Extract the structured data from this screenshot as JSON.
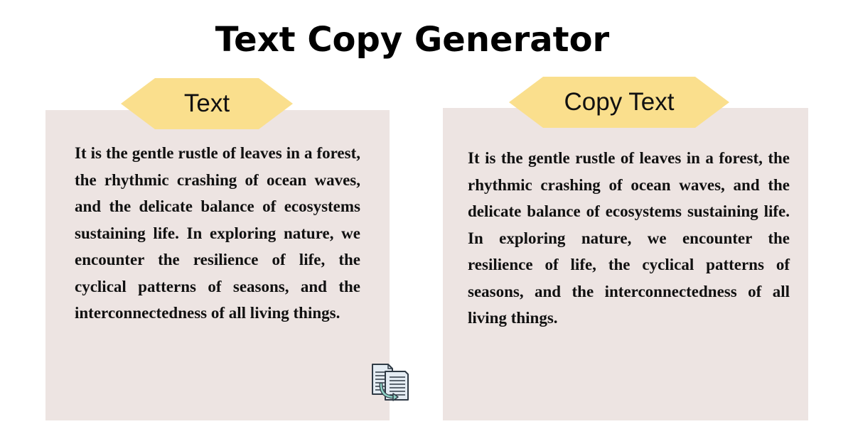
{
  "header": {
    "title": "Text Copy Generator"
  },
  "source_panel": {
    "label": "Text",
    "body": "It is the gentle rustle of leaves in a forest, the rhythmic crashing of ocean waves, and the delicate balance of ecosystems sustaining life. In exploring nature, we encounter the resilience of life, the cyclical patterns of seasons, and the interconnectedness of all living things."
  },
  "copy_panel": {
    "label": "Copy Text",
    "body": "It is the gentle rustle of leaves in a forest, the rhythmic crashing of ocean waves, and the delicate balance of ecosystems sustaining life. In exploring nature, we encounter the resilience of life, the cyclical patterns of seasons, and the interconnectedness of all living things."
  },
  "icons": {
    "copy": "copy-documents-icon"
  },
  "colors": {
    "panel_bg": "#ede4e2",
    "tag_bg": "#fadf8d",
    "text": "#111111"
  }
}
